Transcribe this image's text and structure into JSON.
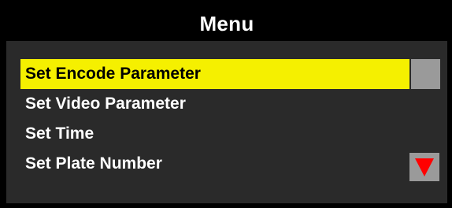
{
  "header": {
    "title": "Menu"
  },
  "menu": {
    "items": [
      {
        "label": "Set Encode Parameter",
        "selected": true
      },
      {
        "label": "Set Video Parameter",
        "selected": false
      },
      {
        "label": "Set Time",
        "selected": false
      },
      {
        "label": "Set Plate Number",
        "selected": false
      }
    ]
  },
  "scrollbar": {
    "down_icon": "triangle-down-icon",
    "thumb_icon": "scroll-thumb"
  },
  "colors": {
    "background": "#2a2a2a",
    "title_bar": "#000000",
    "highlight": "#f5f000",
    "text": "#ffffff",
    "selected_text": "#000000",
    "scroll_block": "#9a9a9a",
    "arrow": "#ff0000"
  }
}
